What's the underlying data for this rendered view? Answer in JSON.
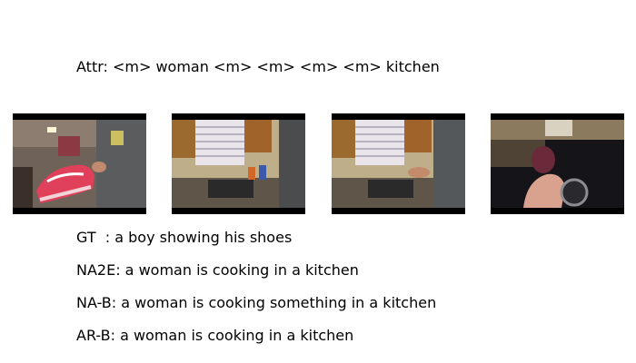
{
  "attr": {
    "text": "Attr: <m> woman <m> <m> <m> <m> kitchen"
  },
  "frames": [
    {
      "depicts": "shoe-being-shown"
    },
    {
      "depicts": "kitchen-sink-window"
    },
    {
      "depicts": "kitchen-sink-window"
    },
    {
      "depicts": "hand-in-kitchen-closeup"
    }
  ],
  "captions": {
    "gt": "GT  : a boy showing his shoes",
    "na2e": "NA2E: a woman is cooking in a kitchen",
    "na_b": "NA-B: a woman is cooking something in a kitchen",
    "ar_b": "AR-B: a woman is cooking in a kitchen"
  }
}
